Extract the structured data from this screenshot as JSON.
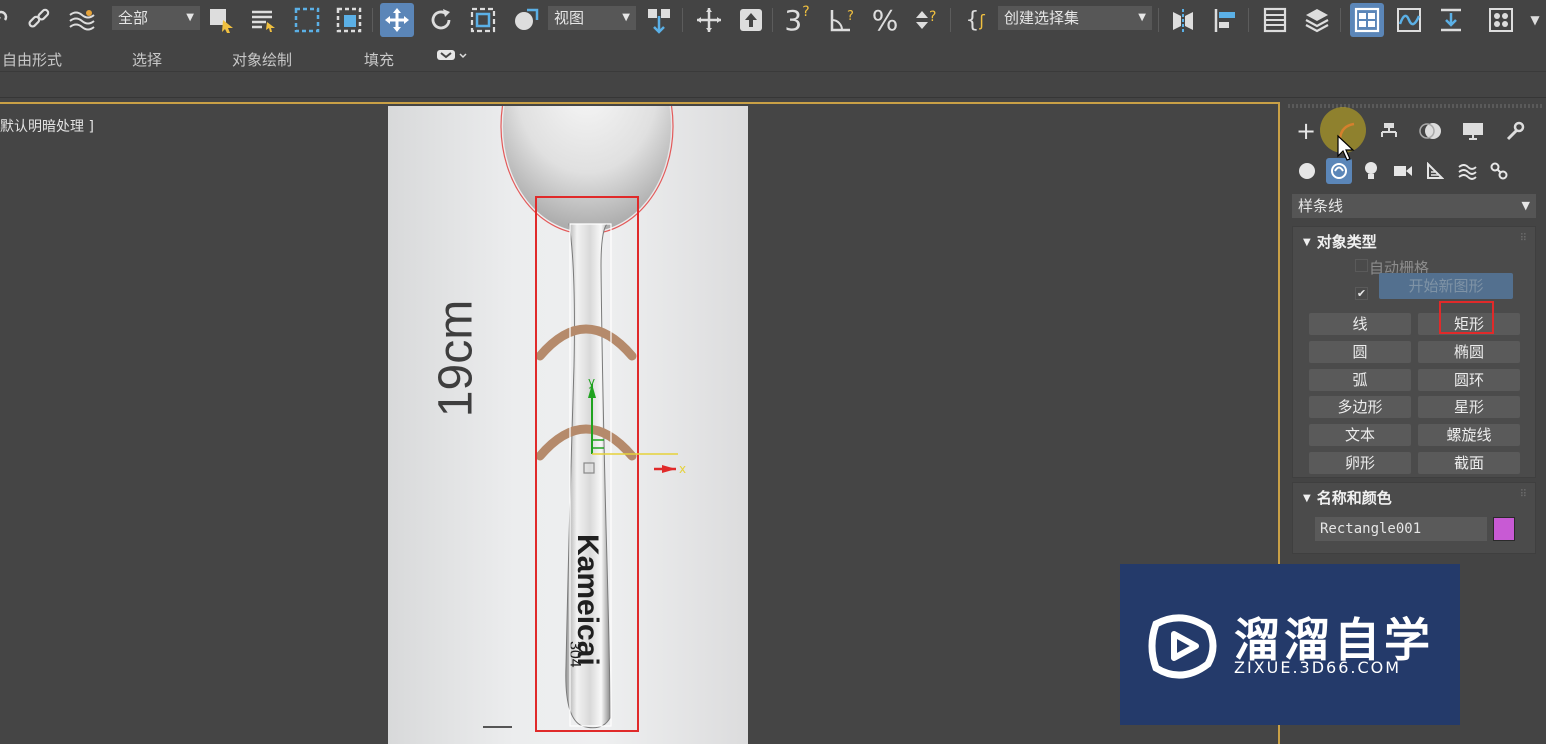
{
  "toolbar": {
    "selection_filter": "全部",
    "reference_coord": "视图",
    "named_selection": "创建选择集",
    "angle_snap_label": "3",
    "colors": {
      "active_button": "#5b86b8",
      "background": "#444444"
    }
  },
  "ribbon": {
    "tabs": [
      "自由形式",
      "选择",
      "对象绘制",
      "填充"
    ]
  },
  "viewport": {
    "label": "默认明暗处理 ]",
    "border_color": "#c9a046",
    "reference_image": {
      "dimension_label": "19cm",
      "brand_text": "Kameicai",
      "model_text": "304"
    },
    "gizmo": {
      "y_axis": "y",
      "x_axis": "x"
    }
  },
  "command_panel": {
    "category_dropdown": "样条线",
    "object_type": {
      "title": "对象类型",
      "auto_grid": "自动栅格",
      "start_new_shape": "开始新图形",
      "buttons": [
        "线",
        "矩形",
        "圆",
        "椭圆",
        "弧",
        "圆环",
        "多边形",
        "星形",
        "文本",
        "螺旋线",
        "卵形",
        "截面"
      ]
    },
    "name_color": {
      "title": "名称和颜色",
      "name_value": "Rectangle001",
      "color": "#c85ad4"
    }
  },
  "watermark": {
    "title": "溜溜自学",
    "subtitle": "ZIXUE.3D66.COM"
  }
}
